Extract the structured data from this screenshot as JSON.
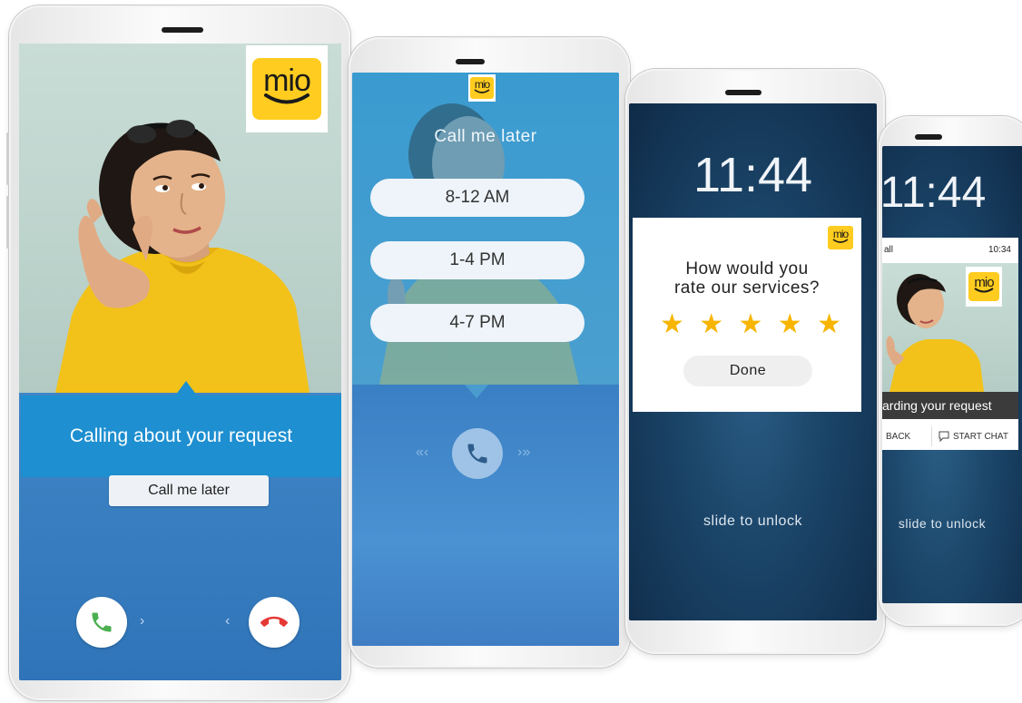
{
  "brand": {
    "logo_text": "mio",
    "color": "#ffcc1f"
  },
  "phone1": {
    "banner_text": "Calling about your request",
    "later_button": "Call me later",
    "accept_icon": "phone-accept-icon",
    "decline_icon": "phone-decline-icon",
    "chevron_right": "›",
    "chevron_left": "‹"
  },
  "phone2": {
    "title": "Call me later",
    "options": [
      "8-12 AM",
      "1-4 PM",
      "4-7 PM"
    ],
    "left_arrows": "«‹",
    "right_arrows": "›»"
  },
  "phone3": {
    "time": "11:44",
    "question_line1": "How would you",
    "question_line2": "rate our services?",
    "rating": 5,
    "max_rating": 5,
    "done_button": "Done",
    "unlock_text": "slide to unlock"
  },
  "phone4": {
    "time": "11:44",
    "notif_title": "all",
    "notif_time": "10:34",
    "banner_text": "arding your request",
    "call_back": "BACK",
    "start_chat": "START CHAT",
    "unlock_text": "slide to unlock"
  }
}
